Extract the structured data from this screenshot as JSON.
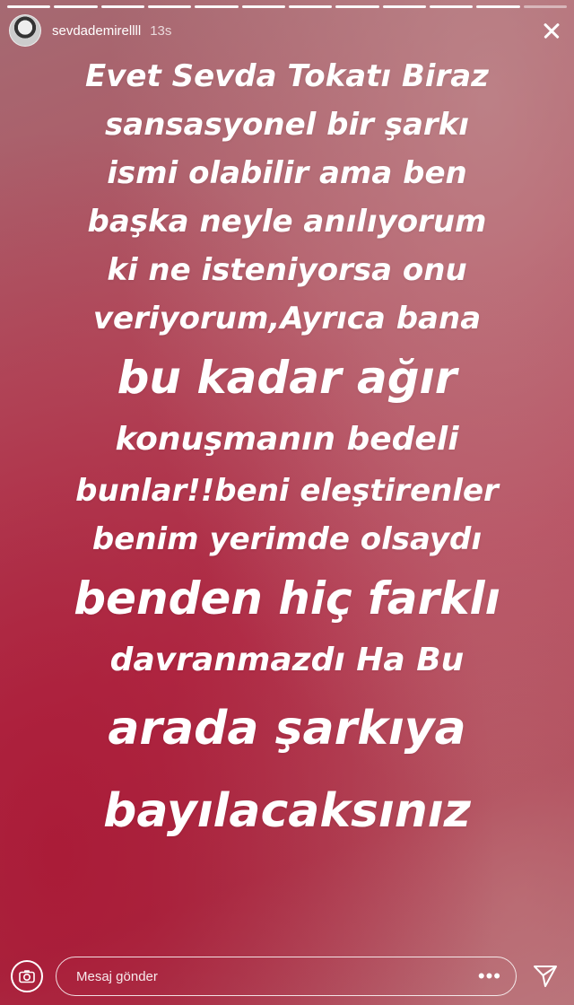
{
  "story": {
    "progress": {
      "total_segments": 12,
      "completed_segments": 11
    },
    "user": {
      "username": "sevdademirellll",
      "time_ago": "13s"
    },
    "text_lines": [
      "Evet Sevda Tokatı Biraz",
      "sansasyonel bir şarkı",
      "ismi olabilir ama ben",
      "başka neyle anılıyorum",
      "ki ne isteniyorsa onu",
      "veriyorum,Ayrıca bana",
      "bu kadar ağır",
      "konuşmanın bedeli",
      "bunlar!!beni eleştirenler",
      "benim yerimde olsaydı",
      "benden hiç farklı",
      "davranmazdı Ha Bu",
      "arada şarkıya",
      "bayılacaksınız"
    ]
  },
  "footer": {
    "reply_placeholder": "Mesaj gönder",
    "more_label": "•••"
  },
  "icons": {
    "close": "close-icon",
    "camera": "camera-icon",
    "send": "send-icon"
  }
}
